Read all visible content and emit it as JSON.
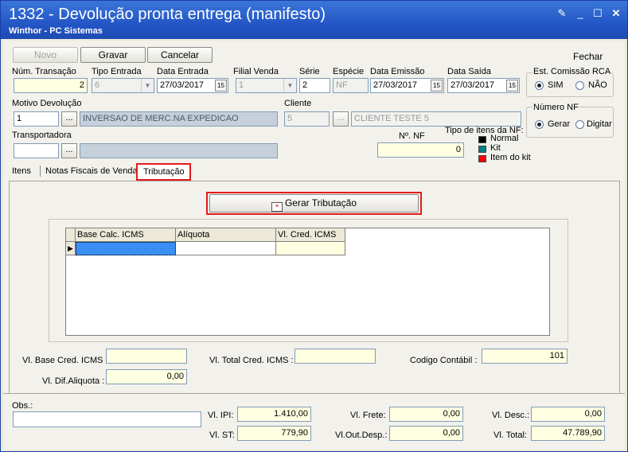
{
  "window": {
    "title": "1332 - Devolução pronta entrega (manifesto)",
    "subtitle": "Winthor - PC Sistemas"
  },
  "toolbar": {
    "novo": "Novo",
    "gravar": "Gravar",
    "cancelar": "Cancelar",
    "fechar": "Fechar"
  },
  "fields": {
    "num_transacao": {
      "label": "Núm. Transação",
      "value": "2"
    },
    "tipo_entrada": {
      "label": "Tipo Entrada",
      "value": "6"
    },
    "data_entrada": {
      "label": "Data Entrada",
      "value": "27/03/2017"
    },
    "filial_venda": {
      "label": "Filial Venda",
      "value": "1"
    },
    "serie": {
      "label": "Série",
      "value": "2"
    },
    "especie": {
      "label": "Espécie",
      "value": "NF"
    },
    "data_emissao": {
      "label": "Data Emissão",
      "value": "27/03/2017"
    },
    "data_saida": {
      "label": "Data Saída",
      "value": "27/03/2017"
    },
    "motivo": {
      "label": "Motivo Devolução",
      "code": "1",
      "desc": "INVERSAO DE MERC.NA EXPEDICAO"
    },
    "cliente": {
      "label": "Cliente",
      "code": "5",
      "desc": "CLIENTE TESTE 5"
    },
    "transportadora": {
      "label": "Transportadora",
      "code": "",
      "desc": ""
    },
    "num_nf": {
      "label": "Nº. NF",
      "value": "0"
    }
  },
  "est_comissao": {
    "title": "Est. Comissão RCA",
    "sim": "SIM",
    "nao": "NÃO",
    "selected": "SIM"
  },
  "numero_nf": {
    "title": "Número NF",
    "gerar": "Gerar",
    "digitar": "Digitar",
    "selected": "Gerar"
  },
  "tipo_itens": {
    "title": "Tipo de itens da NF:",
    "items": [
      {
        "label": "Normal",
        "color": "#000000"
      },
      {
        "label": "Kit",
        "color": "#008080"
      },
      {
        "label": "Item do kit",
        "color": "#ff0000"
      }
    ]
  },
  "tabs": [
    "Itens",
    "Notas Fiscais de Venda",
    "Tributação"
  ],
  "gerar_tributacao": "Gerar Tributação",
  "grid": {
    "columns": [
      "Base Calc. ICMS",
      "Alíquota",
      "Vl. Cred. ICMS"
    ]
  },
  "totals": {
    "vl_base_cred_icms": {
      "label": "Vl. Base Cred. ICMS :",
      "value": ""
    },
    "vl_total_cred_icms": {
      "label": "Vl. Total Cred. ICMS :",
      "value": ""
    },
    "codigo_contabil": {
      "label": "Codigo Contábil :",
      "value": "101"
    },
    "vl_dif_aliquota": {
      "label": "Vl. Dif.Aliquota :",
      "value": "0,00"
    }
  },
  "obs": {
    "label": "Obs.:",
    "value": ""
  },
  "footer": {
    "vl_ipi": {
      "label": "Vl. IPI:",
      "value": "1.410,00"
    },
    "vl_st": {
      "label": "Vl. ST:",
      "value": "779,90"
    },
    "vl_frete": {
      "label": "Vl. Frete:",
      "value": "0,00"
    },
    "vl_out_desp": {
      "label": "Vl.Out.Desp.:",
      "value": "0,00"
    },
    "vl_desc": {
      "label": "Vl. Desc.:",
      "value": "0,00"
    },
    "vl_total": {
      "label": "Vl. Total:",
      "value": "47.789,90"
    }
  },
  "colors": {
    "title_bar": "#2456c6",
    "highlight": "#e31b1b",
    "selected_cell": "#3a8ef5"
  }
}
